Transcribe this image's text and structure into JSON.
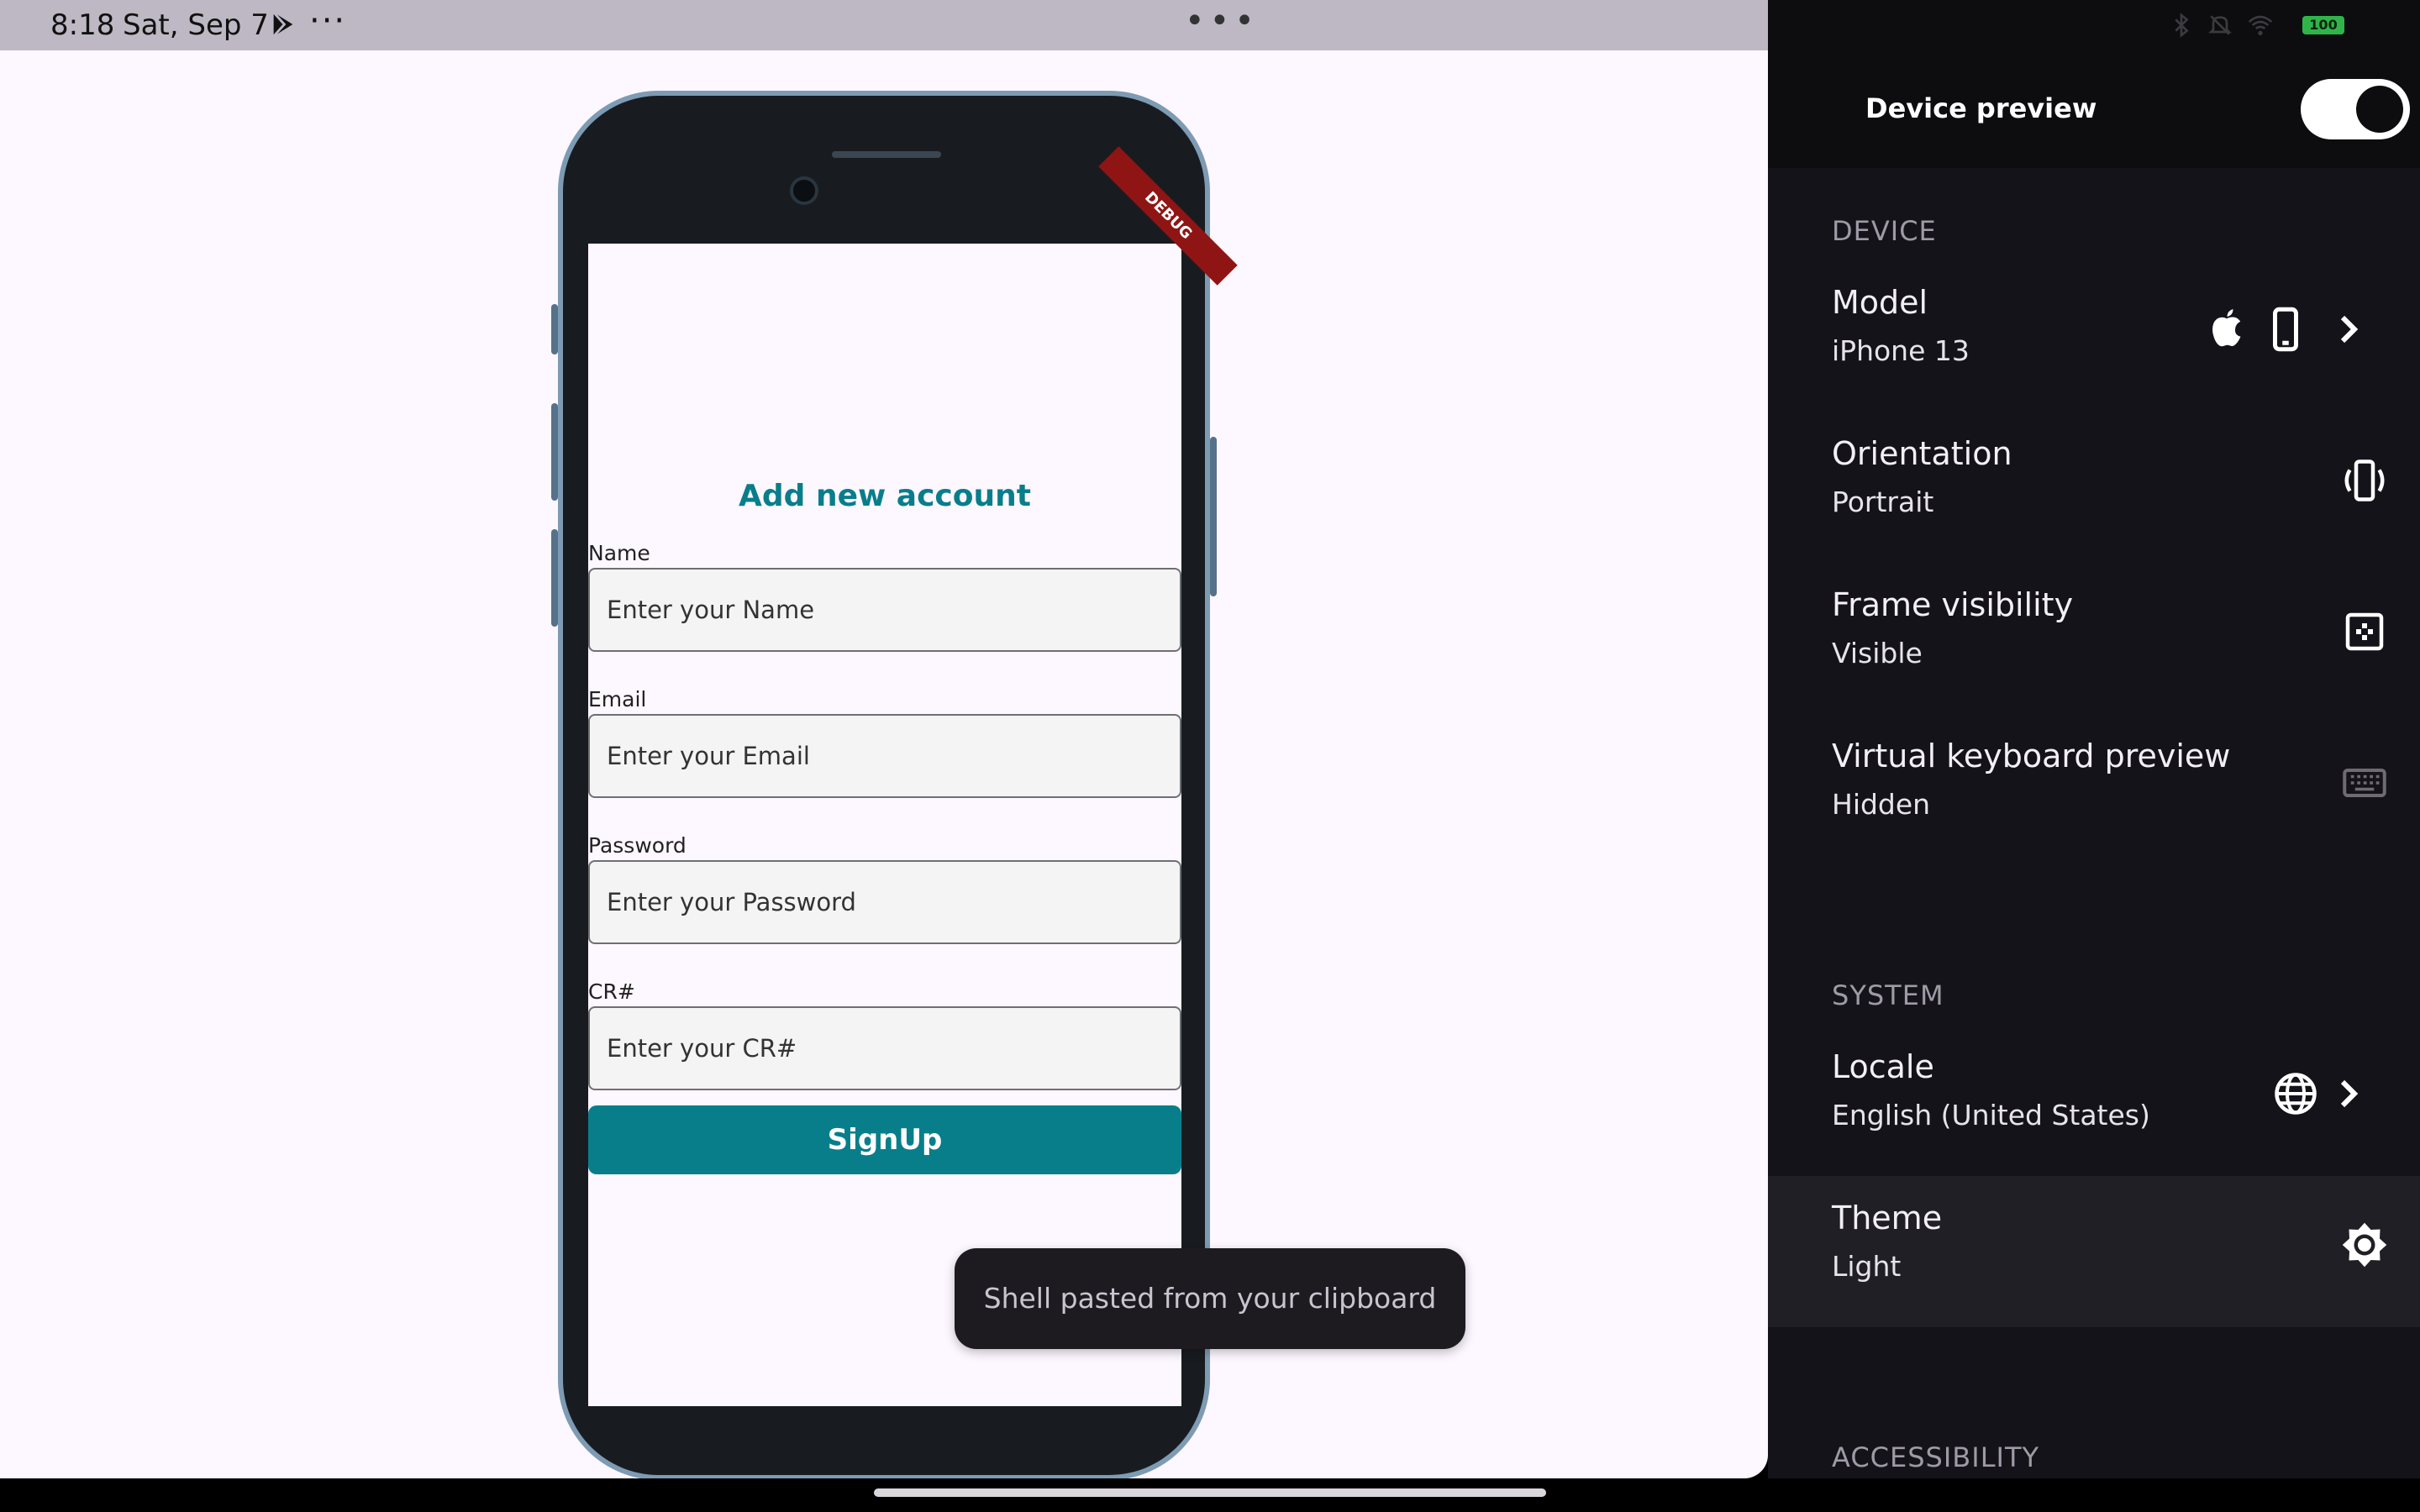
{
  "status_bar": {
    "time": "8:18",
    "date": "Sat, Sep 7",
    "overflow": "···",
    "center_handle": "•••",
    "battery": "100"
  },
  "phone_app": {
    "debug_banner": "DEBUG",
    "title": "Add new account",
    "fields": [
      {
        "label": "Name",
        "placeholder": "Enter your Name"
      },
      {
        "label": "Email",
        "placeholder": "Enter your Email"
      },
      {
        "label": "Password",
        "placeholder": "Enter your Password"
      },
      {
        "label": "CR#",
        "placeholder": "Enter your CR#"
      }
    ],
    "signup_label": "SignUp"
  },
  "toast": {
    "text": "Shell pasted from your clipboard"
  },
  "panel": {
    "title": "Device preview",
    "toggle_on": true,
    "device_section": "DEVICE",
    "model": {
      "title": "Model",
      "value": "iPhone 13"
    },
    "orientation": {
      "title": "Orientation",
      "value": "Portrait"
    },
    "frame": {
      "title": "Frame visibility",
      "value": "Visible"
    },
    "keyboard": {
      "title": "Virtual keyboard preview",
      "value": "Hidden"
    },
    "system_section": "SYSTEM",
    "locale": {
      "title": "Locale",
      "value": "English (United States)"
    },
    "theme": {
      "title": "Theme",
      "value": "Light"
    },
    "accessibility_section": "ACCESSIBILITY"
  },
  "colors": {
    "accent": "#087e8b",
    "panel_bg": "#15131a",
    "screen_bg": "#fdf7ff"
  }
}
